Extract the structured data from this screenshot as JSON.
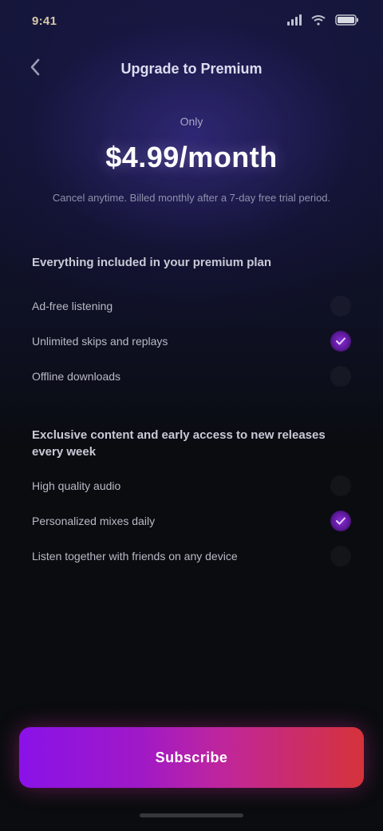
{
  "status_bar": {
    "time": "9:41"
  },
  "header": {
    "title": "Upgrade to Premium"
  },
  "pricing": {
    "label": "Only",
    "price": "$4.99/month",
    "subtitle": "Cancel anytime. Billed monthly after a 7-day free trial period."
  },
  "sections": [
    {
      "heading": "Everything included in your premium plan",
      "features": [
        {
          "label": "Ad-free listening",
          "checked": false
        },
        {
          "label": "Unlimited skips and replays",
          "checked": true
        },
        {
          "label": "Offline downloads",
          "checked": false
        }
      ]
    },
    {
      "heading": "Exclusive content and early access to new releases every week",
      "features": [
        {
          "label": "High quality audio",
          "checked": false
        },
        {
          "label": "Personalized mixes daily",
          "checked": true
        },
        {
          "label": "Listen together with friends on any device",
          "checked": false
        }
      ]
    }
  ],
  "cta": {
    "label": "Subscribe"
  },
  "colors": {
    "accent_start": "#8a12e8",
    "accent_end": "#d5333a",
    "check_on": "#8a2ed6"
  }
}
